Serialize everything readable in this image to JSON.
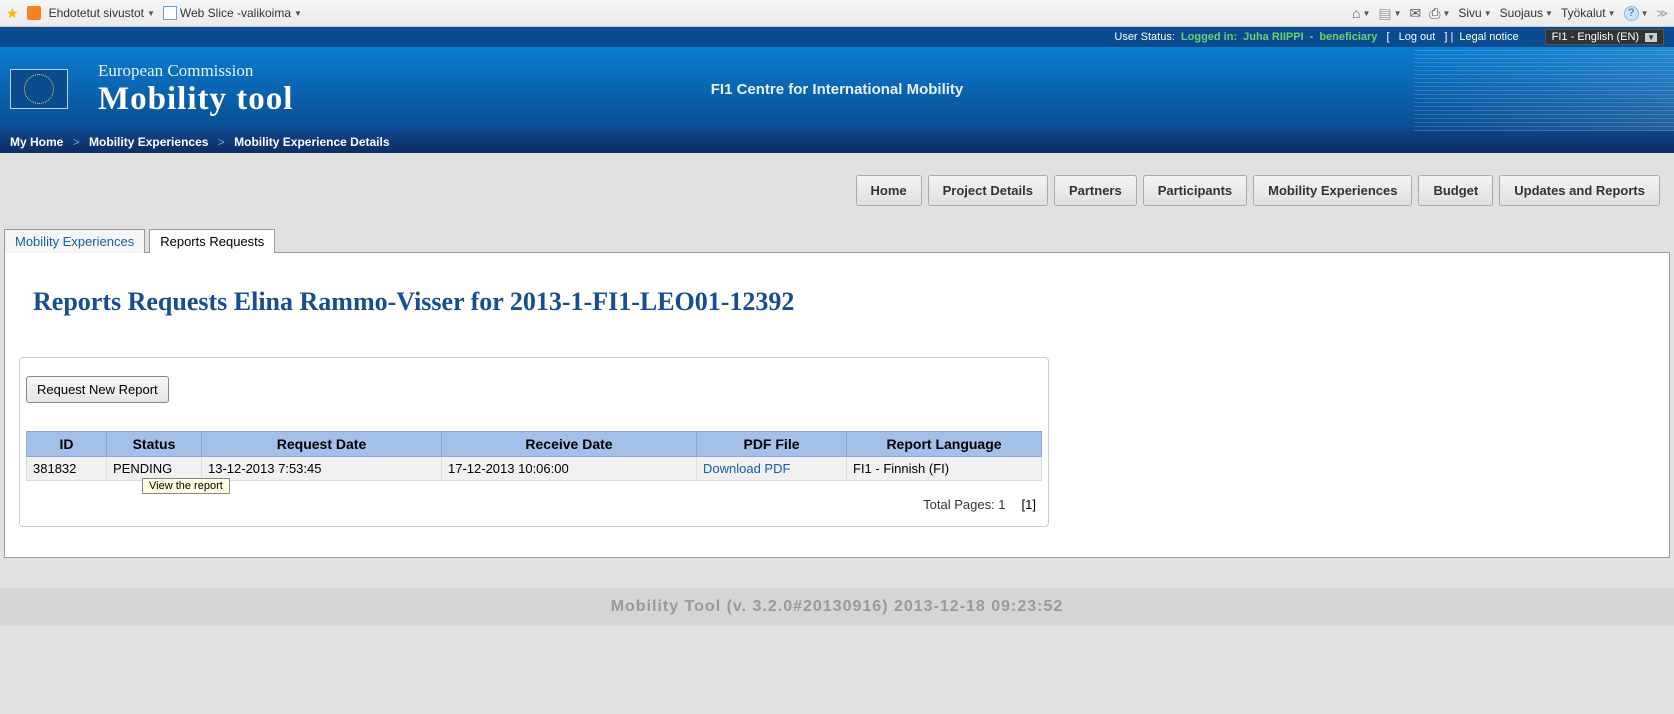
{
  "browser": {
    "suggested_sites": "Ehdotetut sivustot",
    "web_slice": "Web Slice -valikoima",
    "menu_sivu": "Sivu",
    "menu_suojaus": "Suojaus",
    "menu_tyokalut": "Työkalut"
  },
  "status_bar": {
    "user_status_label": "User Status:",
    "logged_in": "Logged in:",
    "user_name": "Juha RIIPPI",
    "dash": " - ",
    "role": "beneficiary",
    "logout": "Log out",
    "legal": "Legal notice",
    "lang": "FI1 - English (EN)"
  },
  "banner": {
    "ec": "European Commission",
    "tool": "Mobility tool",
    "center": "FI1 Centre for International Mobility"
  },
  "breadcrumb": {
    "home": "My Home",
    "l1": "Mobility Experiences",
    "l2": "Mobility Experience Details"
  },
  "nav": {
    "home": "Home",
    "project": "Project Details",
    "partners": "Partners",
    "participants": "Participants",
    "mobexp": "Mobility Experiences",
    "budget": "Budget",
    "updates": "Updates and Reports"
  },
  "tabs": {
    "mobexp": "Mobility Experiences",
    "reports": "Reports Requests"
  },
  "page_title": "Reports Requests Elina Rammo-Visser for 2013-1-FI1-LEO01-12392",
  "request_btn": "Request New Report",
  "table": {
    "headers": {
      "id": "ID",
      "status": "Status",
      "reqdate": "Request Date",
      "recdate": "Receive Date",
      "pdf": "PDF File",
      "lang": "Report Language"
    },
    "row": {
      "id": "381832",
      "status": "PENDING",
      "reqdate": "13-12-2013 7:53:45",
      "recdate": "17-12-2013 10:06:00",
      "pdf": "Download PDF",
      "lang": "FI1 - Finnish (FI)"
    }
  },
  "tooltip": "View the report",
  "pager": {
    "total": "Total Pages: 1",
    "page": "[1]"
  },
  "footer": "Mobility Tool (v. 3.2.0#20130916) 2013-12-18 09:23:52"
}
